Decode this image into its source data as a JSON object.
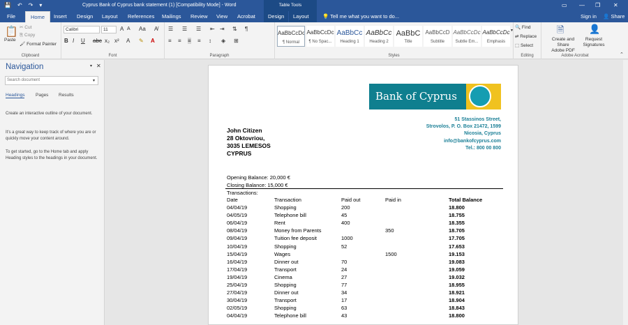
{
  "window": {
    "title": "Cyprus Bank of Cyprus bank statement (1) [Compatibility Mode] - Word",
    "table_tools": "Table Tools"
  },
  "tabs": [
    "File",
    "Home",
    "Insert",
    "Design",
    "Layout",
    "References",
    "Mailings",
    "Review",
    "View",
    "Acrobat",
    "Design",
    "Layout"
  ],
  "tell_me": "Tell me what you want to do...",
  "account": {
    "sign_in": "Sign in",
    "share": "Share"
  },
  "ribbon": {
    "clipboard": {
      "paste": "Paste",
      "cut": "Cut",
      "copy": "Copy",
      "format_painter": "Format Painter",
      "label": "Clipboard"
    },
    "font": {
      "name": "Calibri",
      "size": "11",
      "label": "Font"
    },
    "paragraph": {
      "label": "Paragraph"
    },
    "styles": {
      "label": "Styles",
      "items": [
        {
          "preview": "AaBbCcDc",
          "name": "¶ Normal"
        },
        {
          "preview": "AaBbCcDc",
          "name": "¶ No Spac..."
        },
        {
          "preview": "AaBbCc",
          "name": "Heading 1"
        },
        {
          "preview": "AaBbCc",
          "name": "Heading 2"
        },
        {
          "preview": "AaBbC",
          "name": "Title"
        },
        {
          "preview": "AaBbCcD",
          "name": "Subtitle"
        },
        {
          "preview": "AaBbCcDc",
          "name": "Subtle Em..."
        },
        {
          "preview": "AaBbCcDc",
          "name": "Emphasis"
        }
      ]
    },
    "editing": {
      "find": "Find",
      "replace": "Replace",
      "select": "Select",
      "label": "Editing"
    },
    "acrobat": {
      "create": "Create and Share",
      "create2": "Adobe PDF",
      "request": "Request",
      "request2": "Signatures",
      "label": "Adobe Acrobat"
    }
  },
  "nav": {
    "title": "Navigation",
    "search_placeholder": "Search document",
    "tabs": [
      "Headings",
      "Pages",
      "Results"
    ],
    "text": [
      "Create an interactive outline of your document.",
      "It's a great way to keep track of where you are or quickly move your content around.",
      "To get started, go to the Home tab and apply Heading styles to the headings in your document."
    ]
  },
  "doc": {
    "logo_text": "Bank of Cyprus",
    "bank_address": [
      "51 Stassinos Street,",
      "Strovolos, P. O. Box 21472, 1599",
      "Nicosia, Cyprus",
      "info@bankofcyprus.com",
      "Tel.: 800 00 800"
    ],
    "recipient": [
      "John Citizen",
      "28 Oktovriou,",
      "3035 LEMESOS",
      "CYPRUS"
    ],
    "opening": "Opening Balance: 20,000  €",
    "closing": "Closing Balance:  15,000  €",
    "transactions_label": "Transactions:",
    "headers": [
      "Date",
      "Transaction",
      "Paid out",
      "Paid in",
      "Total Balance"
    ],
    "rows": [
      [
        "04/04/19",
        "Shopping",
        "200",
        "",
        "18.800"
      ],
      [
        "04/05/19",
        "Telephone bill",
        "45",
        "",
        "18.755"
      ],
      [
        "06/04/19",
        "Rent",
        "400",
        "",
        "18.355"
      ],
      [
        "08/04/19",
        "Money from Parents",
        "",
        "350",
        "18.705"
      ],
      [
        "09/04/19",
        "Tuition fee deposit",
        "1000",
        "",
        "17.705"
      ],
      [
        "10/04/19",
        "Shopping",
        "52",
        "",
        "17.653"
      ],
      [
        "15/04/19",
        "Wages",
        "",
        "1500",
        "19.153"
      ],
      [
        "16/04/19",
        "Dinner out",
        "70",
        "",
        "19.083"
      ],
      [
        "17/04/19",
        "Transport",
        "24",
        "",
        "19.059"
      ],
      [
        "19/04/19",
        "Cinema",
        "27",
        "",
        "19.032"
      ],
      [
        "25/04/19",
        "Shopping",
        "77",
        "",
        "18.955"
      ],
      [
        "27/04/19",
        "Dinner out",
        "34",
        "",
        "18.921"
      ],
      [
        "30/04/19",
        "Transport",
        "17",
        "",
        "18.904"
      ],
      [
        "02/05/19",
        "Shopping",
        "63",
        "",
        "18.843"
      ],
      [
        "04/04/19",
        "Telephone bill",
        "43",
        "",
        "18.800"
      ]
    ]
  }
}
